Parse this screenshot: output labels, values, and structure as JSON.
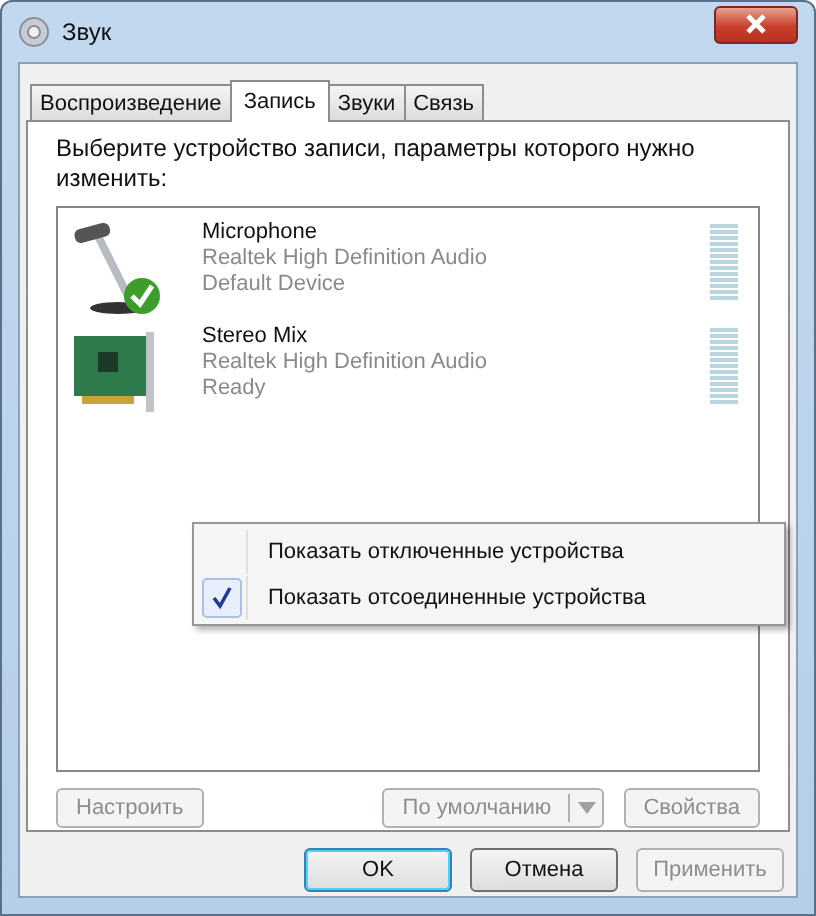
{
  "window": {
    "title": "Звук"
  },
  "tabs": [
    {
      "label": "Воспроизведение",
      "selected": false
    },
    {
      "label": "Запись",
      "selected": true
    },
    {
      "label": "Звуки",
      "selected": false
    },
    {
      "label": "Связь",
      "selected": false
    }
  ],
  "instruction": "Выберите устройство записи, параметры которого нужно изменить:",
  "devices": [
    {
      "kind": "microphone",
      "name": "Microphone",
      "driver": "Realtek High Definition Audio",
      "status": "Default Device",
      "default": true
    },
    {
      "kind": "card",
      "name": "Stereo Mix",
      "driver": "Realtek High Definition Audio",
      "status": "Ready",
      "default": false
    }
  ],
  "context_menu": [
    {
      "label": "Показать отключенные устройства",
      "checked": false
    },
    {
      "label": "Показать отсоединенные устройства",
      "checked": true
    }
  ],
  "device_buttons": [
    {
      "kind": "button",
      "label": "Настроить",
      "disabled": true
    },
    {
      "kind": "split",
      "label": "По умолчанию",
      "disabled": true
    },
    {
      "kind": "button",
      "label": "Свойства",
      "disabled": true
    }
  ],
  "dialog_buttons": [
    {
      "label": "OK",
      "disabled": false,
      "default": true
    },
    {
      "label": "Отмена",
      "disabled": false,
      "default": false
    },
    {
      "label": "Применить",
      "disabled": true,
      "default": false
    }
  ]
}
